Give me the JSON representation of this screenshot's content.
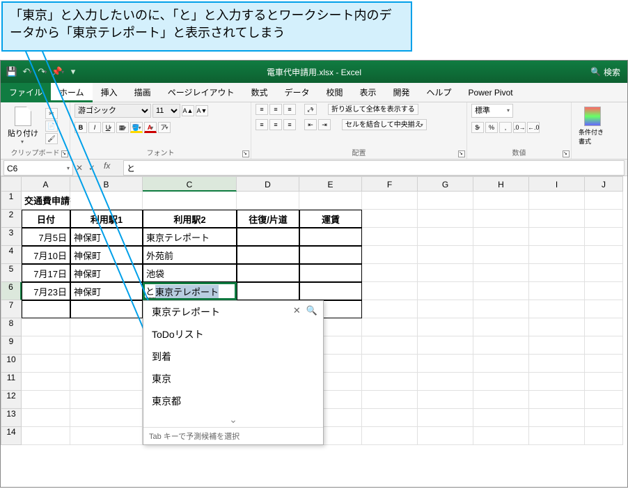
{
  "callout": {
    "text": "「東京」と入力したいのに、「と」と入力するとワークシート内のデータから「東京テレポート」と表示されてしまう"
  },
  "title": "電車代申請用.xlsx  -  Excel",
  "search_label": "検索",
  "tabs": {
    "file": "ファイル",
    "home": "ホーム",
    "insert": "挿入",
    "draw": "描画",
    "layout": "ページレイアウト",
    "formulas": "数式",
    "data": "データ",
    "review": "校閲",
    "view": "表示",
    "developer": "開発",
    "help": "ヘルプ",
    "pivot": "Power Pivot"
  },
  "groups": {
    "clipboard": "クリップボード",
    "font": "フォント",
    "align": "配置",
    "number": "数値"
  },
  "font": {
    "name": "游ゴシック",
    "size": "11"
  },
  "paste": "貼り付け",
  "align_buttons": {
    "wrap": "折り返して全体を表示する",
    "merge": "セルを結合して中央揃え"
  },
  "number_format": {
    "style": "標準"
  },
  "cond_format": "条件付き書式",
  "cell": {
    "ref": "C6",
    "formula": "と"
  },
  "sheet_title": "交通費申請書",
  "headers": {
    "date": "日付",
    "st1": "利用駅1",
    "st2": "利用駅2",
    "rt": "往復/片道",
    "fare": "運賃"
  },
  "rows": [
    {
      "date": "7月5日",
      "st1": "神保町",
      "st2": "東京テレポート"
    },
    {
      "date": "7月10日",
      "st1": "神保町",
      "st2": "外苑前"
    },
    {
      "date": "7月17日",
      "st1": "神保町",
      "st2": "池袋"
    },
    {
      "date": "7月23日",
      "st1": "神保町",
      "st2": ""
    }
  ],
  "editing": {
    "typed": "と",
    "autocomplete": "東京テレポート"
  },
  "ime": {
    "candidates": [
      "東京テレポート",
      "ToDoリスト",
      "到着",
      "東京",
      "東京都"
    ],
    "hint": "Tab キーで予測候補を選択"
  }
}
